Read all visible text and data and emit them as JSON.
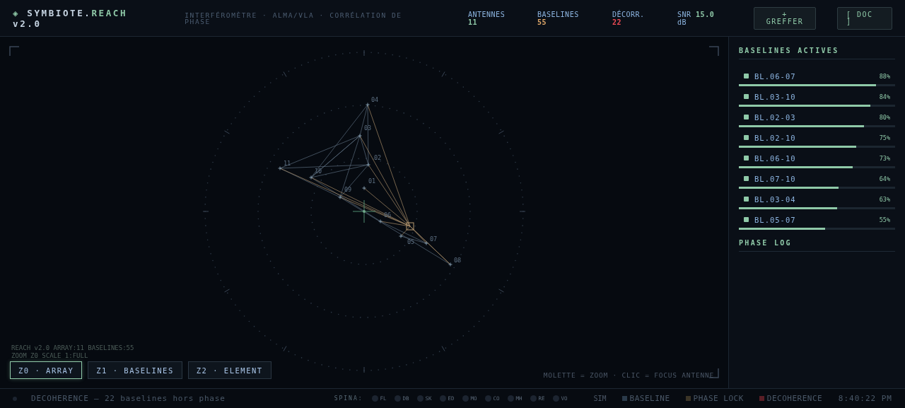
{
  "header": {
    "logo_mark": "◈",
    "brand": "SYMBIOTE.",
    "brand_accent": "REACH",
    "version": "v2.0",
    "subtitle": "INTERFÉROMÈTRE · ALMA/VLA · CORRÉLATION DE PHASE",
    "stats": [
      {
        "kind": "stacked",
        "label": "ANTENNES",
        "value": "11",
        "color": "#8fc9a8"
      },
      {
        "kind": "stacked",
        "label": "BASELINES",
        "value": "55",
        "color": "#e0a86a"
      },
      {
        "kind": "stacked",
        "label": "DÉCORR.",
        "value": "22",
        "color": "#ef4a55"
      },
      {
        "kind": "inline",
        "label": "SNR",
        "value": "15.0",
        "unit": "dB",
        "color": "#8fc9a8"
      }
    ],
    "buttons": [
      "+ GREFFER",
      "[ DOC ]"
    ]
  },
  "array": {
    "antennas": [
      "01",
      "02",
      "03",
      "04",
      "05",
      "06",
      "07",
      "08",
      "09",
      "10",
      "11"
    ],
    "info_lines": [
      "REACH v2.0  ARRAY:11  BASELINES:55",
      "ZOOM Z0  SCALE 1:FULL"
    ],
    "zoom_buttons": [
      {
        "label": "Z0 · ARRAY",
        "selected": true
      },
      {
        "label": "Z1 · BASELINES",
        "selected": false
      },
      {
        "label": "Z2 · ELEMENT",
        "selected": false
      }
    ],
    "hint": "MOLETTE = ZOOM · CLIC = FOCUS ANTENNE"
  },
  "sidebar": {
    "title": "BASELINES ACTIVES",
    "baselines": [
      {
        "name": "BL.06-07",
        "reading": "88%",
        "level": 0.88
      },
      {
        "name": "BL.03-10",
        "reading": "84%",
        "level": 0.84
      },
      {
        "name": "BL.02-03",
        "reading": "80%",
        "level": 0.8
      },
      {
        "name": "BL.02-10",
        "reading": "75%",
        "level": 0.75
      },
      {
        "name": "BL.06-10",
        "reading": "73%",
        "level": 0.73
      },
      {
        "name": "BL.07-10",
        "reading": "64%",
        "level": 0.64
      },
      {
        "name": "BL.03-04",
        "reading": "63%",
        "level": 0.63
      },
      {
        "name": "BL.05-07",
        "reading": "55%",
        "level": 0.55
      }
    ],
    "log_title": "PHASE LOG"
  },
  "status_bar": {
    "message": "DECOHERENCE — 22 baselines hors phase",
    "spina_label": "SPINA:",
    "spina": [
      "FL",
      "DB",
      "SK",
      "ED",
      "MO",
      "CO",
      "MH",
      "RE",
      "VO"
    ],
    "mode": "SIM",
    "legend": [
      {
        "label": "BASELINE",
        "color": "#2a3a4a"
      },
      {
        "label": "PHASE LOCK",
        "color": "#3a3426"
      },
      {
        "label": "DECOHERENCE",
        "color": "#5a1e26"
      }
    ],
    "time": "8:40:22 PM"
  }
}
